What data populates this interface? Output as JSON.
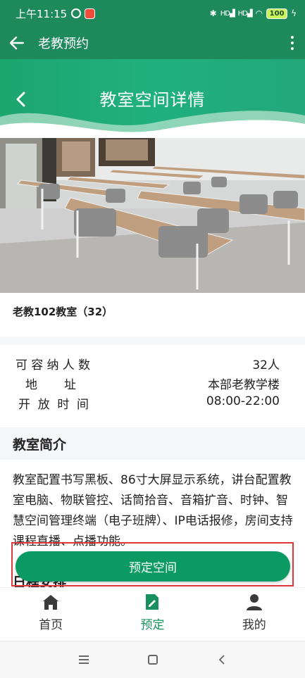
{
  "status_bar": {
    "time": "上午11:15",
    "battery": "100",
    "signal_text": "HD",
    "alarm_icon": "alarm-clock-icon",
    "app_icon": "app-notification-icon"
  },
  "app_bar": {
    "title": "老教预约",
    "back_icon": "arrow-left-icon",
    "more_icon": "more-vertical-icon"
  },
  "page_header": {
    "title": "教室空间详情",
    "back_icon": "chevron-left-icon",
    "colors": {
      "start": "#1da56e",
      "end": "#23a77b"
    }
  },
  "room": {
    "name": "老教102教室（32）"
  },
  "info": [
    {
      "label": "可容纳人数",
      "value": "32人"
    },
    {
      "label": "地址",
      "value": "本部老教学楼"
    },
    {
      "label": "开放时间",
      "value": "08:00-22:00"
    }
  ],
  "intro": {
    "title": "教室简介",
    "text": "教室配置书写黑板、86寸大屏显示系统，讲台配置教室电脑、物联管控、话筒拾音、音箱扩音、时钟、智慧空间管理终端（电子班牌）、IP电话报修，房间支持课程直播、点播功能。"
  },
  "schedule": {
    "title": "日程安排"
  },
  "book_button": {
    "label": "预定空间",
    "color": "#0a9a62",
    "highlight_color": "#e0383a"
  },
  "tabs": [
    {
      "label": "首页",
      "icon": "home-icon",
      "active": false
    },
    {
      "label": "预定",
      "icon": "edit-document-icon",
      "active": true
    },
    {
      "label": "我的",
      "icon": "user-icon",
      "active": false
    }
  ],
  "accent": "#16915d"
}
